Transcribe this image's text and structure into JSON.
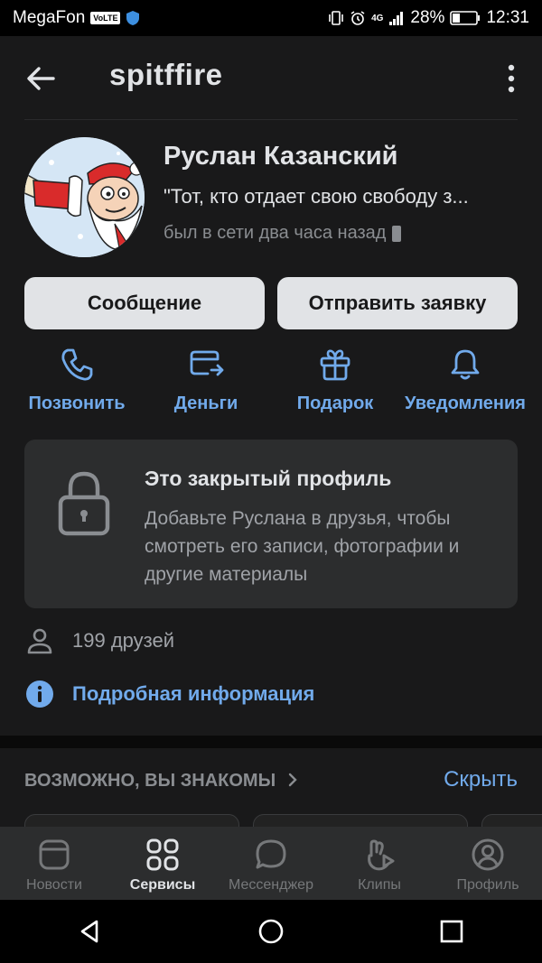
{
  "status_bar": {
    "carrier": "MegaFon",
    "volte": "VoLTE",
    "network": "4G",
    "battery": "28%",
    "time": "12:31"
  },
  "header": {
    "title": "spitffire",
    "back_icon": "arrow-left-icon",
    "more_icon": "more-vertical-icon"
  },
  "profile": {
    "name": "Руслан Казанский",
    "status": "\"Тот, кто отдает свою свободу з...",
    "last_seen": "был в сети два часа назад"
  },
  "buttons": {
    "message": "Сообщение",
    "add_friend": "Отправить заявку"
  },
  "actions": [
    {
      "label": "Позвонить",
      "icon": "phone-icon"
    },
    {
      "label": "Деньги",
      "icon": "money-transfer-icon"
    },
    {
      "label": "Подарок",
      "icon": "gift-icon"
    },
    {
      "label": "Уведомления",
      "icon": "bell-icon"
    }
  ],
  "closed_profile": {
    "title": "Это закрытый профиль",
    "text": "Добавьте Руслана в друзья, чтобы смотреть его записи, фотографии и другие материалы"
  },
  "friends": "199 друзей",
  "details": "Подробная информация",
  "pymk": {
    "title": "ВОЗМОЖНО, ВЫ ЗНАКОМЫ",
    "hide": "Скрыть"
  },
  "tabbar": [
    {
      "label": "Новости",
      "icon": "news-icon",
      "active": false
    },
    {
      "label": "Сервисы",
      "icon": "services-icon",
      "active": true
    },
    {
      "label": "Мессенджер",
      "icon": "messenger-icon",
      "active": false
    },
    {
      "label": "Клипы",
      "icon": "clips-icon",
      "active": false
    },
    {
      "label": "Профиль",
      "icon": "profile-icon",
      "active": false
    }
  ],
  "colors": {
    "accent": "#71aaeb",
    "background": "#19191a",
    "card": "#2c2d2e"
  }
}
